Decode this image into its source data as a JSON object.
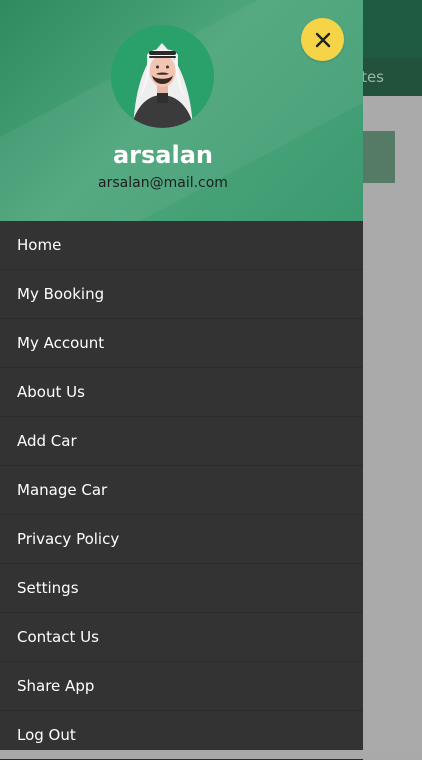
{
  "background": {
    "tab_fragment": "tes"
  },
  "drawer": {
    "user": {
      "name": "arsalan",
      "email": "arsalan@mail.com"
    },
    "close_icon": "close-icon",
    "menu": [
      {
        "label": "Home"
      },
      {
        "label": "My Booking"
      },
      {
        "label": "My Account"
      },
      {
        "label": "About Us"
      },
      {
        "label": "Add Car"
      },
      {
        "label": "Manage Car"
      },
      {
        "label": "Privacy Policy"
      },
      {
        "label": "Settings"
      },
      {
        "label": "Contact Us"
      },
      {
        "label": "Share App"
      },
      {
        "label": "Log Out"
      }
    ]
  },
  "colors": {
    "header_green": "#3c9a70",
    "drawer_bg": "#333333",
    "close_button": "#f6d448",
    "app_bar": "#1f5a42"
  }
}
